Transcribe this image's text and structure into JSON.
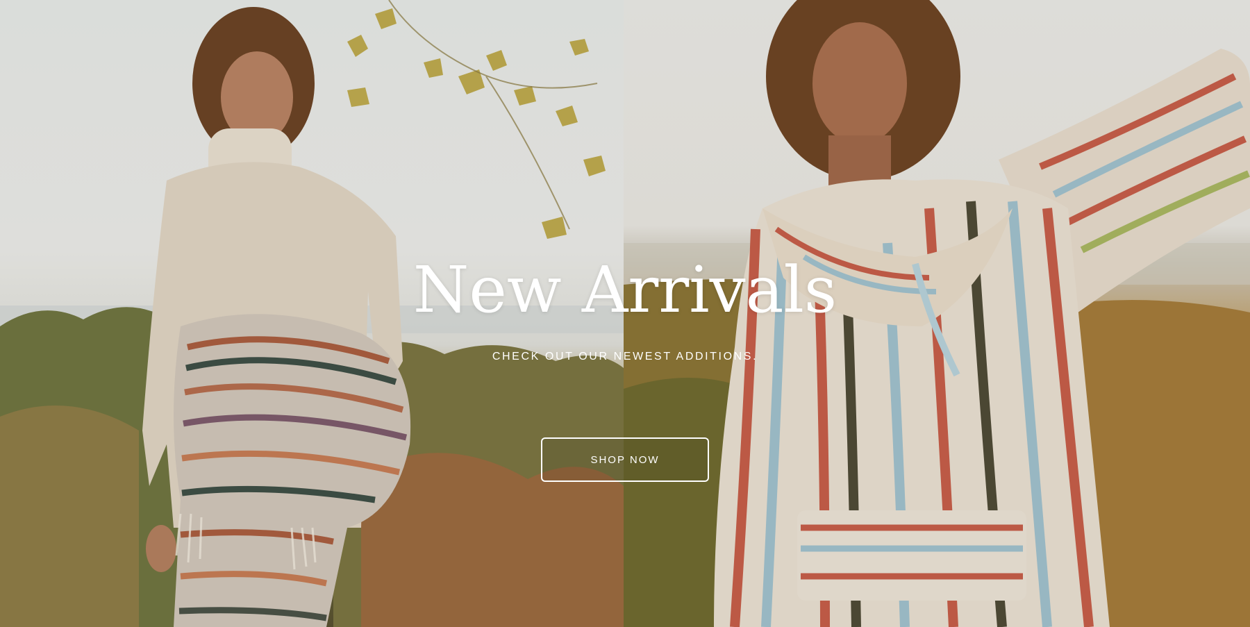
{
  "hero": {
    "title": "New Arrivals",
    "subtitle": "CHECK OUT OUR NEWEST ADDITIONS.",
    "cta_label": "SHOP NOW"
  },
  "colors": {
    "text": "#ffffff",
    "button_border": "#ffffff"
  }
}
